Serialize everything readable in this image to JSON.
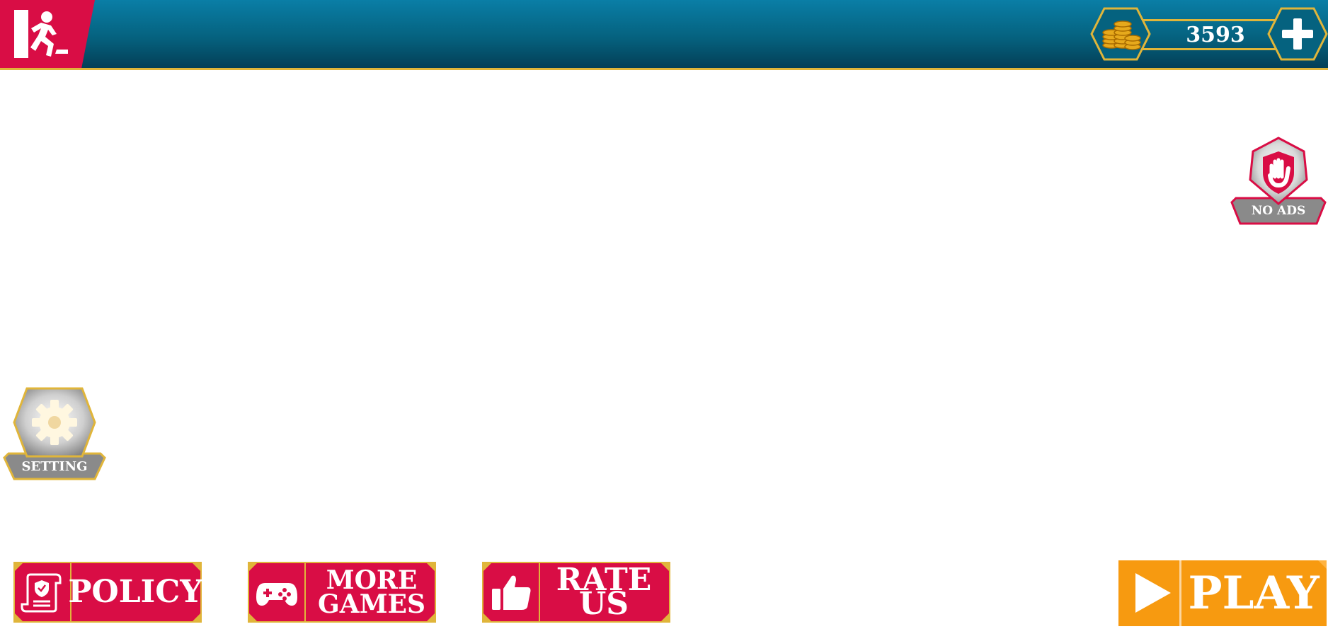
{
  "header": {
    "exit_icon": "exit-door-runner-icon",
    "coins": {
      "icon": "gold-coins-icon",
      "value": "3593",
      "add_icon": "plus-icon"
    }
  },
  "side": {
    "no_ads": {
      "label": "NO ADS",
      "icon": "stop-hand-icon"
    },
    "setting": {
      "label": "SETTING",
      "icon": "gear-icon"
    }
  },
  "bottom": {
    "policy": {
      "label": "POLICY",
      "icon": "policy-document-icon"
    },
    "more_games": {
      "label": "MORE GAMES",
      "icon": "gamepad-icon"
    },
    "rate_us": {
      "label": "RATE US",
      "icon": "thumbs-up-icon"
    },
    "play": {
      "label": "PLAY",
      "icon": "play-triangle-icon"
    }
  },
  "colors": {
    "header_blue": "#05627f",
    "brand_red": "#d90d45",
    "gold_border": "#e0b53a",
    "play_orange": "#f79a10"
  }
}
